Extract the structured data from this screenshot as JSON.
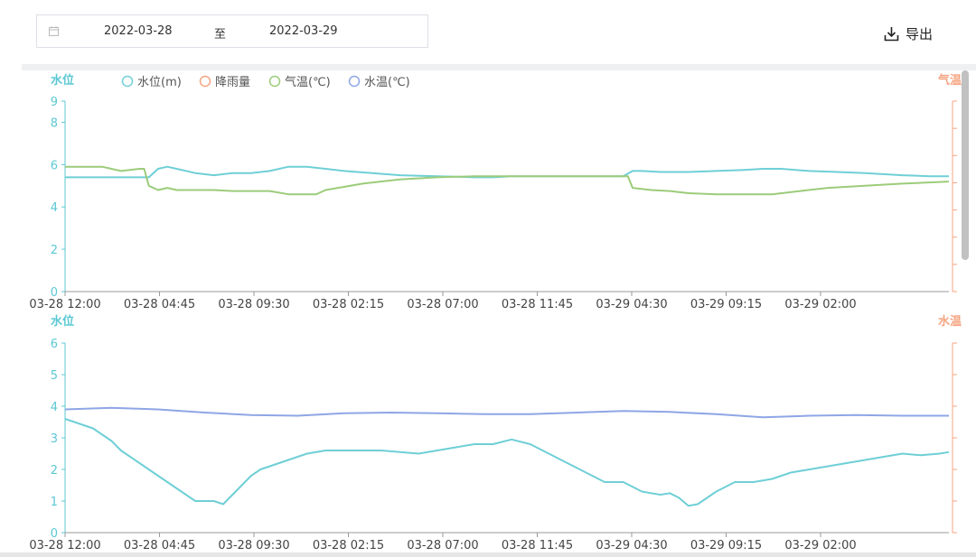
{
  "toolbar": {
    "start_date": "2022-03-28",
    "separator": "至",
    "end_date": "2022-03-29",
    "export_label": "导出"
  },
  "legend": [
    {
      "label": "水位(m)",
      "color": "#6fcfd6"
    },
    {
      "label": "降雨量",
      "color": "#f5a481"
    },
    {
      "label": "气温(℃)",
      "color": "#9ccc7a"
    },
    {
      "label": "水温(℃)",
      "color": "#8ea6e6"
    }
  ],
  "chart_data": [
    {
      "type": "line",
      "left_axis_label": "水位",
      "right_axis_label": "气温",
      "x_tick_labels": [
        "03-28 12:00",
        "03-28 04:45",
        "03-28 09:30",
        "03-28 02:15",
        "03-28 07:00",
        "03-28 11:45",
        "03-29 04:30",
        "03-29 09:15",
        "03-29 02:00"
      ],
      "y_ticks": [
        0,
        2,
        4,
        6,
        8,
        9
      ],
      "ylim": [
        0,
        9
      ],
      "x_range": [
        0,
        95
      ],
      "series": [
        {
          "name": "水位(m)",
          "color": "#6fcfd6",
          "x": [
            0,
            4,
            8,
            9,
            10,
            11,
            12,
            14,
            16,
            18,
            20,
            22,
            24,
            26,
            28,
            30,
            33,
            36,
            40,
            44,
            46,
            48,
            50,
            52,
            55,
            58,
            60,
            61,
            62,
            64,
            67,
            70,
            73,
            75,
            77,
            80,
            83,
            86,
            90,
            93,
            95
          ],
          "y": [
            5.4,
            5.4,
            5.4,
            5.4,
            5.8,
            5.9,
            5.8,
            5.6,
            5.5,
            5.6,
            5.6,
            5.7,
            5.9,
            5.9,
            5.8,
            5.7,
            5.6,
            5.5,
            5.45,
            5.4,
            5.4,
            5.45,
            5.45,
            5.45,
            5.45,
            5.45,
            5.45,
            5.7,
            5.7,
            5.65,
            5.65,
            5.7,
            5.75,
            5.8,
            5.8,
            5.7,
            5.65,
            5.6,
            5.5,
            5.45,
            5.45
          ]
        },
        {
          "name": "气温(℃)",
          "color": "#9ccc7a",
          "x": [
            0,
            4,
            6,
            8,
            8.5,
            9,
            10,
            11,
            12,
            14,
            16,
            18,
            20,
            22,
            24,
            26,
            27,
            28,
            32,
            36,
            40,
            44,
            48,
            52,
            56,
            60,
            60.5,
            61,
            63,
            65,
            67,
            70,
            73,
            76,
            79,
            82,
            86,
            90,
            95
          ],
          "y": [
            5.9,
            5.9,
            5.7,
            5.8,
            5.8,
            5.0,
            4.8,
            4.9,
            4.8,
            4.8,
            4.8,
            4.75,
            4.75,
            4.75,
            4.6,
            4.6,
            4.6,
            4.8,
            5.1,
            5.3,
            5.4,
            5.45,
            5.45,
            5.45,
            5.45,
            5.45,
            5.45,
            4.9,
            4.8,
            4.75,
            4.65,
            4.6,
            4.6,
            4.6,
            4.75,
            4.9,
            5.0,
            5.1,
            5.2
          ]
        }
      ]
    },
    {
      "type": "line",
      "left_axis_label": "水位",
      "right_axis_label": "水温",
      "x_tick_labels": [
        "03-28 12:00",
        "03-28 04:45",
        "03-28 09:30",
        "03-28 02:15",
        "03-28 07:00",
        "03-28 11:45",
        "03-29 04:30",
        "03-29 09:15",
        "03-29 02:00"
      ],
      "y_ticks": [
        0,
        1,
        2,
        3,
        4,
        5,
        6
      ],
      "ylim": [
        0,
        6
      ],
      "x_range": [
        0,
        95
      ],
      "series": [
        {
          "name": "水位(m)",
          "color": "#6fcfd6",
          "x": [
            0,
            1,
            2,
            3,
            4,
            5,
            6,
            7,
            8,
            10,
            12,
            14,
            16,
            17,
            18,
            19,
            20,
            21,
            22,
            24,
            26,
            28,
            30,
            32,
            34,
            36,
            38,
            40,
            42,
            44,
            46,
            48,
            50,
            52,
            54,
            56,
            58,
            60,
            62,
            63,
            64,
            65,
            66,
            67,
            68,
            70,
            72,
            74,
            76,
            78,
            80,
            82,
            84,
            86,
            88,
            90,
            92,
            94,
            95
          ],
          "y": [
            3.6,
            3.5,
            3.4,
            3.3,
            3.1,
            2.9,
            2.6,
            2.4,
            2.2,
            1.8,
            1.4,
            1.0,
            1.0,
            0.9,
            1.2,
            1.5,
            1.8,
            2.0,
            2.1,
            2.3,
            2.5,
            2.6,
            2.6,
            2.6,
            2.6,
            2.55,
            2.5,
            2.6,
            2.7,
            2.8,
            2.8,
            2.95,
            2.8,
            2.5,
            2.2,
            1.9,
            1.6,
            1.6,
            1.3,
            1.25,
            1.2,
            1.25,
            1.1,
            0.85,
            0.9,
            1.3,
            1.6,
            1.6,
            1.7,
            1.9,
            2.0,
            2.1,
            2.2,
            2.3,
            2.4,
            2.5,
            2.45,
            2.5,
            2.55
          ]
        },
        {
          "name": "水温(℃)",
          "color": "#8ea6e6",
          "x": [
            0,
            5,
            10,
            15,
            20,
            25,
            30,
            35,
            40,
            45,
            50,
            55,
            60,
            65,
            70,
            75,
            80,
            85,
            90,
            95
          ],
          "y": [
            3.9,
            3.95,
            3.9,
            3.8,
            3.72,
            3.7,
            3.78,
            3.8,
            3.78,
            3.75,
            3.75,
            3.8,
            3.85,
            3.82,
            3.75,
            3.65,
            3.7,
            3.72,
            3.7,
            3.7
          ]
        }
      ]
    }
  ]
}
